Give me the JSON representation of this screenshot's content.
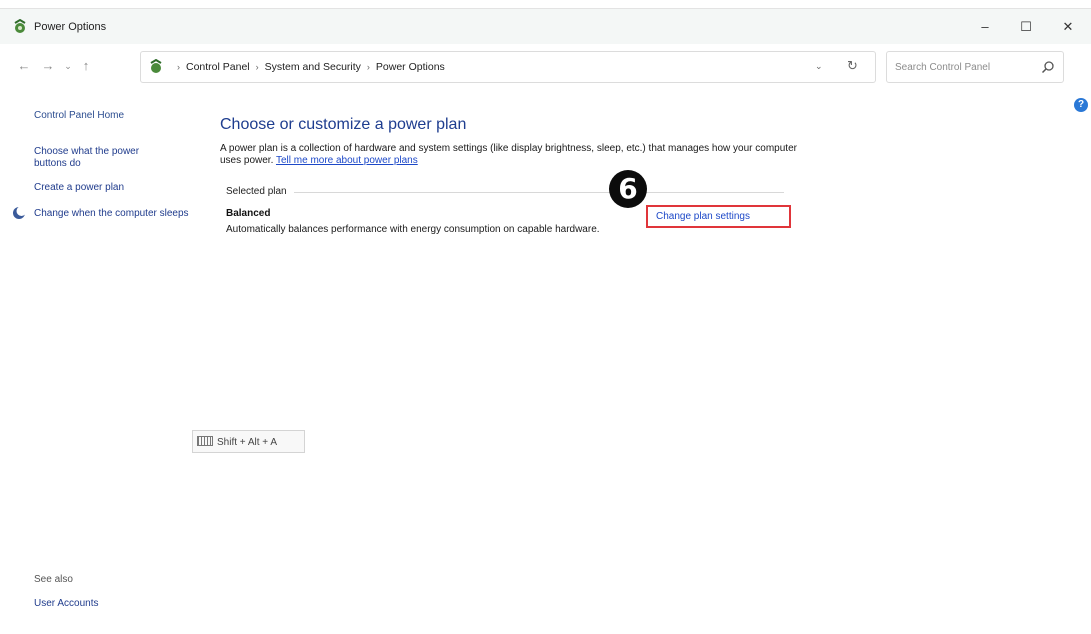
{
  "window": {
    "title": "Power Options",
    "minimize": "–",
    "maximize": "☐",
    "close": "✕"
  },
  "nav": {
    "back": "←",
    "forward": "→",
    "recent": "⌄",
    "up": "↑",
    "breadcrumbs": [
      "Control Panel",
      "System and Security",
      "Power Options"
    ],
    "separator": "›",
    "dropdown": "⌄",
    "refresh": "↻",
    "search_placeholder": "Search Control Panel"
  },
  "sidebar": {
    "home": "Control Panel Home",
    "power_buttons": "Choose what the power buttons do",
    "create_plan": "Create a power plan",
    "sleep": "Change when the computer sleeps"
  },
  "main": {
    "title": "Choose or customize a power plan",
    "description": "A power plan is a collection of hardware and system settings (like display brightness, sleep, etc.) that manages how your computer uses power.",
    "tell_more": "Tell me more about power plans",
    "selected_plan_label": "Selected plan",
    "plan_name": "Balanced",
    "plan_description": "Automatically balances performance with energy consumption on capable hardware.",
    "change_settings": "Change plan settings",
    "step_number": "6"
  },
  "shortcut": {
    "text": "Shift + Alt + A"
  },
  "see_also": {
    "label": "See also",
    "user_accounts": "User Accounts"
  },
  "colors": {
    "link": "#1c48c8",
    "title_blue": "#1e3d8f",
    "highlight_red": "#e0353a",
    "help_blue": "#2a78d6"
  }
}
